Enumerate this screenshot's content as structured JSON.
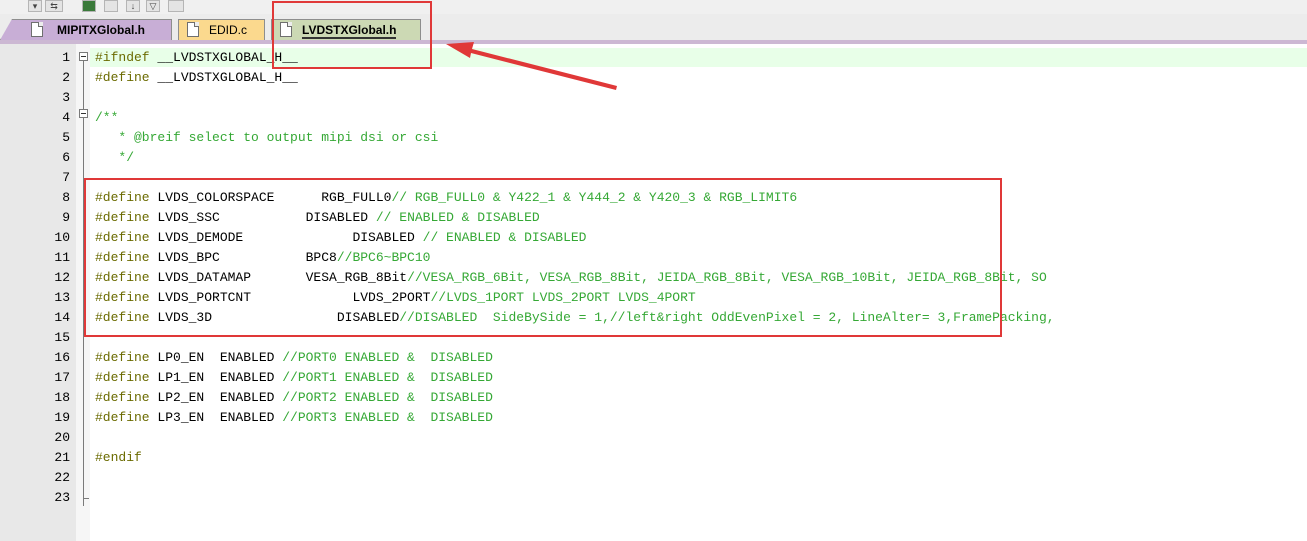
{
  "tabs": [
    {
      "label": "MIPITXGlobal.h"
    },
    {
      "label": "EDID.c"
    },
    {
      "label": "LVDSTXGlobal.h"
    }
  ],
  "toolbar_icons": [
    "dropdown-icon",
    "replace-icon",
    "color-block-icon",
    "window-icon",
    "down-arrow-icon",
    "filter-icon",
    "image-icon"
  ],
  "editor": {
    "lines": [
      {
        "n": "1",
        "parts": [
          {
            "c": "pp",
            "t": "#ifndef"
          },
          {
            "c": "id",
            "t": " __LVDSTXGLOBAL_H__"
          }
        ]
      },
      {
        "n": "2",
        "parts": [
          {
            "c": "pp",
            "t": "#define"
          },
          {
            "c": "id",
            "t": " __LVDSTXGLOBAL_H__"
          }
        ]
      },
      {
        "n": "3",
        "parts": []
      },
      {
        "n": "4",
        "parts": [
          {
            "c": "cm",
            "t": "/**"
          }
        ]
      },
      {
        "n": "5",
        "parts": [
          {
            "c": "cm",
            "t": "   * @breif select to output mipi dsi or csi"
          }
        ]
      },
      {
        "n": "6",
        "parts": [
          {
            "c": "cm",
            "t": "   */"
          }
        ]
      },
      {
        "n": "7",
        "parts": []
      },
      {
        "n": "8",
        "parts": [
          {
            "c": "pp",
            "t": "#define"
          },
          {
            "c": "id",
            "t": " LVDS_COLORSPACE      RGB_FULL0"
          },
          {
            "c": "cm",
            "t": "// RGB_FULL0 & Y422_1 & Y444_2 & Y420_3 & RGB_LIMIT6"
          }
        ]
      },
      {
        "n": "9",
        "parts": [
          {
            "c": "pp",
            "t": "#define"
          },
          {
            "c": "id",
            "t": " LVDS_SSC           DISABLED "
          },
          {
            "c": "cm",
            "t": "// ENABLED & DISABLED"
          }
        ]
      },
      {
        "n": "10",
        "parts": [
          {
            "c": "pp",
            "t": "#define"
          },
          {
            "c": "id",
            "t": " LVDS_DEMODE              DISABLED "
          },
          {
            "c": "cm",
            "t": "// ENABLED & DISABLED"
          }
        ]
      },
      {
        "n": "11",
        "parts": [
          {
            "c": "pp",
            "t": "#define"
          },
          {
            "c": "id",
            "t": " LVDS_BPC           BPC8"
          },
          {
            "c": "cm",
            "t": "//BPC6~BPC10"
          }
        ]
      },
      {
        "n": "12",
        "parts": [
          {
            "c": "pp",
            "t": "#define"
          },
          {
            "c": "id",
            "t": " LVDS_DATAMAP       VESA_RGB_8Bit"
          },
          {
            "c": "cm",
            "t": "//VESA_RGB_6Bit, VESA_RGB_8Bit, JEIDA_RGB_8Bit, VESA_RGB_10Bit, JEIDA_RGB_8Bit, SO"
          }
        ]
      },
      {
        "n": "13",
        "parts": [
          {
            "c": "pp",
            "t": "#define"
          },
          {
            "c": "id",
            "t": " LVDS_PORTCNT             LVDS_2PORT"
          },
          {
            "c": "cm",
            "t": "//LVDS_1PORT LVDS_2PORT LVDS_4PORT"
          }
        ]
      },
      {
        "n": "14",
        "parts": [
          {
            "c": "pp",
            "t": "#define"
          },
          {
            "c": "id",
            "t": " LVDS_3D                DISABLED"
          },
          {
            "c": "cm",
            "t": "//DISABLED  SideBySide = 1,//left&right OddEvenPixel = 2, LineAlter= 3,FramePacking,"
          }
        ]
      },
      {
        "n": "15",
        "parts": []
      },
      {
        "n": "16",
        "parts": [
          {
            "c": "pp",
            "t": "#define"
          },
          {
            "c": "id",
            "t": " LP0_EN  ENABLED "
          },
          {
            "c": "cm",
            "t": "//PORT0 ENABLED &  DISABLED"
          }
        ]
      },
      {
        "n": "17",
        "parts": [
          {
            "c": "pp",
            "t": "#define"
          },
          {
            "c": "id",
            "t": " LP1_EN  ENABLED "
          },
          {
            "c": "cm",
            "t": "//PORT1 ENABLED &  DISABLED"
          }
        ]
      },
      {
        "n": "18",
        "parts": [
          {
            "c": "pp",
            "t": "#define"
          },
          {
            "c": "id",
            "t": " LP2_EN  ENABLED "
          },
          {
            "c": "cm",
            "t": "//PORT2 ENABLED &  DISABLED"
          }
        ]
      },
      {
        "n": "19",
        "parts": [
          {
            "c": "pp",
            "t": "#define"
          },
          {
            "c": "id",
            "t": " LP3_EN  ENABLED "
          },
          {
            "c": "cm",
            "t": "//PORT3 ENABLED &  DISABLED"
          }
        ]
      },
      {
        "n": "20",
        "parts": []
      },
      {
        "n": "21",
        "parts": [
          {
            "c": "pp",
            "t": "#endif"
          }
        ]
      },
      {
        "n": "22",
        "parts": []
      },
      {
        "n": "23",
        "parts": []
      }
    ]
  },
  "colors": {
    "annotation_red": "#e03838",
    "comment_green": "#35a835",
    "preprocessor": "#6b6b00"
  }
}
